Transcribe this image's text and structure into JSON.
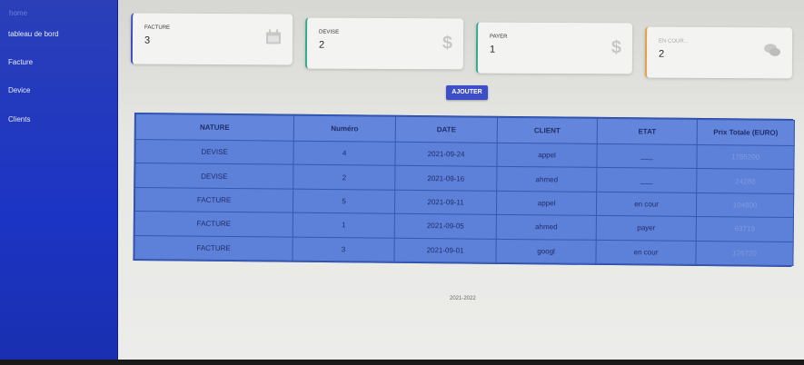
{
  "sidebar": {
    "brand": "home",
    "items": [
      {
        "label": "tableau de bord"
      },
      {
        "label": "Facture"
      },
      {
        "label": "Device"
      },
      {
        "label": "Clients"
      }
    ]
  },
  "cards": {
    "facture": {
      "label": "FACTURE",
      "value": "3",
      "icon": "calendar-icon"
    },
    "devise": {
      "label": "DEVISE",
      "value": "2",
      "icon": "dollar-icon"
    },
    "payer": {
      "label": "PAYER",
      "value": "1",
      "icon": "dollar-icon"
    },
    "encours": {
      "label": "EN COUR...",
      "value": "2",
      "icon": "comments-icon"
    }
  },
  "toolbar": {
    "add_label": "AJOUTER"
  },
  "table": {
    "headers": [
      "NATURE",
      "Numéro",
      "DATE",
      "CLIENT",
      "ETAT",
      "Prix Totale (EURO)"
    ],
    "rows": [
      [
        "DEVISE",
        "4",
        "2021-09-24",
        "appel",
        "___",
        "1785200"
      ],
      [
        "DEVISE",
        "2",
        "2021-09-16",
        "ahmed",
        "___",
        "24288"
      ],
      [
        "FACTURE",
        "5",
        "2021-09-11",
        "appel",
        "en cour",
        "104800"
      ],
      [
        "FACTURE",
        "1",
        "2021-09-05",
        "ahmed",
        "payer",
        "63719"
      ],
      [
        "FACTURE",
        "3",
        "2021-09-01",
        "googl",
        "en cour",
        "126720"
      ]
    ]
  },
  "footer": {
    "text": "2021-2022"
  },
  "colors": {
    "sidebar": "#1c34c4",
    "table": "#5b7fd8",
    "button": "#3c4fc8"
  }
}
